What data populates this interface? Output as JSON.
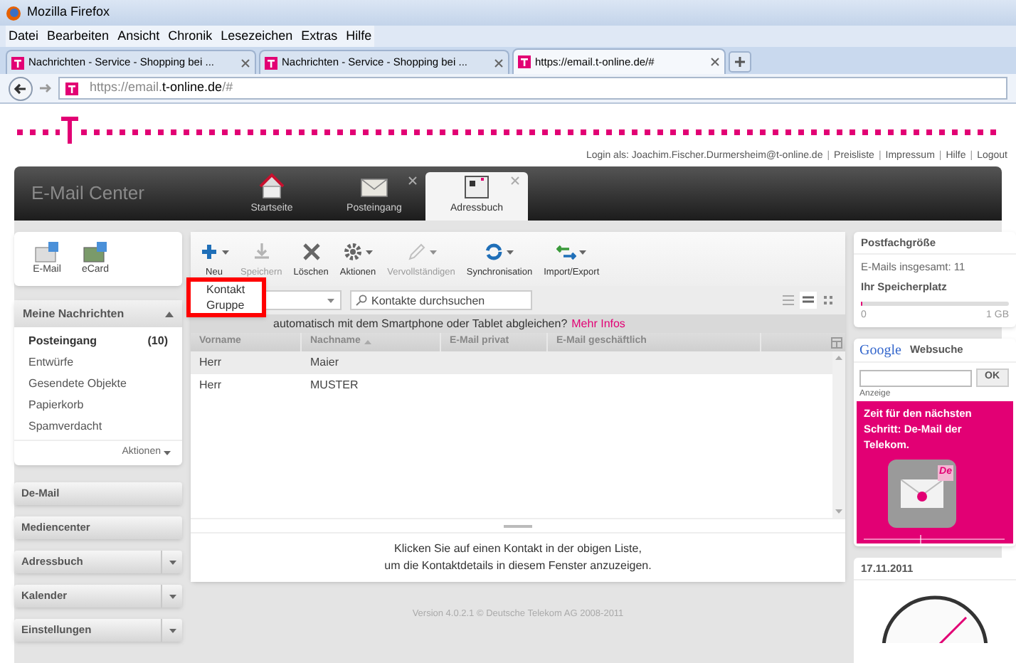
{
  "window": {
    "title": "Mozilla Firefox"
  },
  "menu_bar": [
    "Datei",
    "Bearbeiten",
    "Ansicht",
    "Chronik",
    "Lesezeichen",
    "Extras",
    "Hilfe"
  ],
  "browser_tabs": [
    {
      "title": "Nachrichten - Service - Shopping bei ...",
      "selected": false
    },
    {
      "title": "Nachrichten - Service - Shopping bei ...",
      "selected": false
    },
    {
      "title": "https://email.t-online.de/#",
      "selected": true
    }
  ],
  "address_bar": {
    "url_prefix": "https://email.",
    "url_domain": "t-online.de",
    "url_suffix": "/#"
  },
  "top_links": [
    {
      "kind": "text",
      "label": "Login als: Joachim.Fischer.Durmersheim@t-online.de"
    },
    {
      "kind": "separator",
      "label": "|"
    },
    {
      "kind": "link",
      "label": "Preisliste"
    },
    {
      "kind": "separator",
      "label": "|"
    },
    {
      "kind": "link",
      "label": "Impressum"
    },
    {
      "kind": "separator",
      "label": "|"
    },
    {
      "kind": "link",
      "label": "Hilfe"
    },
    {
      "kind": "separator",
      "label": "|"
    },
    {
      "kind": "link",
      "label": "Logout"
    }
  ],
  "header": {
    "title": "E-Mail Center",
    "tabs": [
      {
        "label": "Startseite",
        "kind": "home",
        "selected": false,
        "closable": false
      },
      {
        "label": "Posteingang",
        "kind": "mail",
        "selected": false,
        "closable": true
      },
      {
        "label": "Adressbuch",
        "kind": "book",
        "selected": true,
        "closable": true
      }
    ]
  },
  "sidebar": {
    "quick": [
      {
        "label": "E-Mail",
        "kind": "mail"
      },
      {
        "label": "eCard",
        "kind": "card"
      }
    ],
    "messages": {
      "title": "Meine Nachrichten",
      "expanded": true,
      "items": [
        {
          "label": "Posteingang",
          "count": "(10)",
          "selected": true
        },
        {
          "label": "Entwürfe",
          "selected": false
        },
        {
          "label": "Gesendete Objekte",
          "selected": false
        },
        {
          "label": "Papierkorb",
          "selected": false
        },
        {
          "label": "Spamverdacht",
          "selected": false
        }
      ],
      "actions": "Aktionen"
    },
    "sections": [
      {
        "label": "De-Mail",
        "dropdown": false
      },
      {
        "label": "Mediencenter",
        "dropdown": false
      },
      {
        "label": "Adressbuch",
        "dropdown": true
      },
      {
        "label": "Kalender",
        "dropdown": true
      },
      {
        "label": "Einstellungen",
        "dropdown": true
      }
    ]
  },
  "toolbar": [
    {
      "label": "Neu",
      "kind": "plus",
      "disabled": false,
      "menu": true
    },
    {
      "label": "Speichern",
      "kind": "save",
      "disabled": true,
      "menu": false
    },
    {
      "label": "Löschen",
      "kind": "delete",
      "disabled": false,
      "menu": false
    },
    {
      "label": "Aktionen",
      "kind": "gear",
      "disabled": false,
      "menu": true
    },
    {
      "label": "Vervollständigen",
      "kind": "pen",
      "disabled": true,
      "menu": true
    },
    {
      "label": "Synchronisation",
      "kind": "sync",
      "disabled": false,
      "menu": true
    },
    {
      "label": "Import/Export",
      "kind": "arrows",
      "disabled": false,
      "menu": true
    }
  ],
  "new_menu": [
    "Kontakt",
    "Gruppe"
  ],
  "search": {
    "placeholder": "Kontakte durchsuchen"
  },
  "view_modes": [
    {
      "kind": "list",
      "selected": false
    },
    {
      "kind": "compact",
      "selected": true
    },
    {
      "kind": "grid",
      "selected": false
    }
  ],
  "info_banner": {
    "text": "automatisch mit dem Smartphone oder Tablet abgleichen?",
    "link": "Mehr Infos"
  },
  "table": {
    "columns": [
      "Vorname",
      "Nachname",
      "E-Mail privat",
      "E-Mail geschäftlich"
    ],
    "rows": [
      {
        "cells": [
          "Herr",
          "Maier"
        ],
        "selected": true
      },
      {
        "cells": [
          "Herr",
          "MUSTER"
        ],
        "selected": false
      }
    ]
  },
  "details_hint": [
    "Klicken Sie auf einen Kontakt in der obigen Liste,",
    "um die Kontaktdetails in diesem Fenster anzuzeigen."
  ],
  "footer": "Version 4.0.2.1 © Deutsche Telekom AG 2008-2011",
  "mailbox": {
    "title": "Postfachgröße",
    "total": "E-Mails insgesamt: 11",
    "storage_label": "Ihr Speicherplatz",
    "level": 0.01,
    "min": "0",
    "max": "1 GB"
  },
  "websearch": {
    "brand": "Google",
    "title": "Websuche",
    "button": "OK"
  },
  "ad": {
    "label": "Anzeige",
    "text": "Zeit für den nächsten Schritt: De-Mail der Telekom.",
    "badge": "De"
  },
  "date_card": {
    "date": "17.11.2011"
  }
}
